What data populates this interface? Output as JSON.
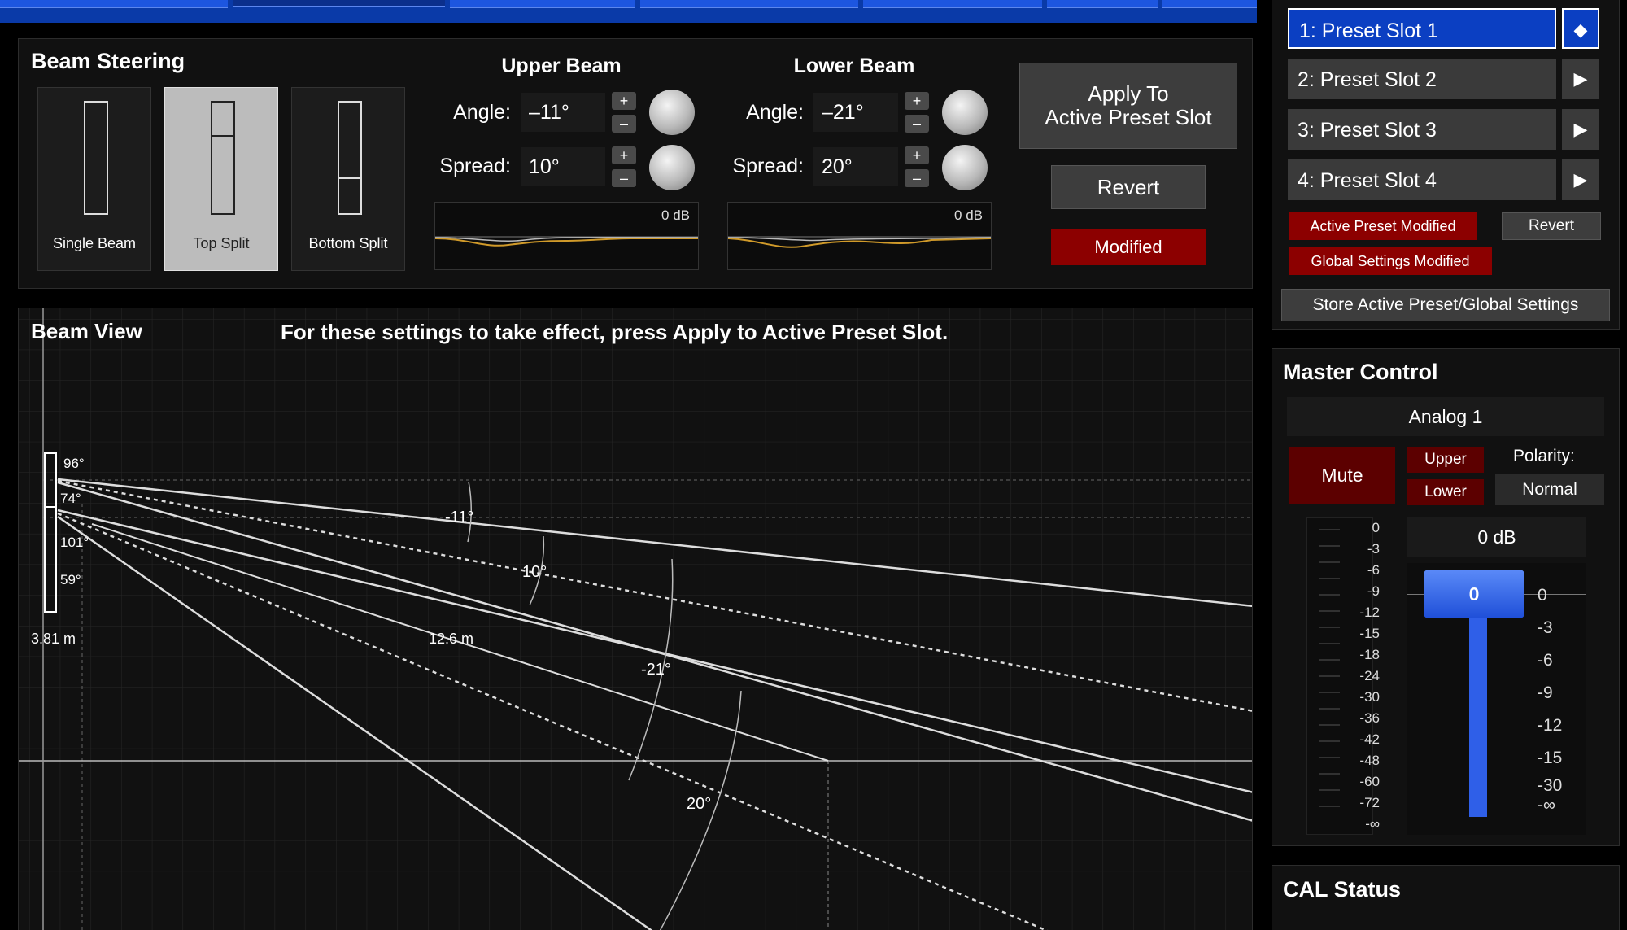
{
  "beam_steering": {
    "title": "Beam Steering",
    "modes": [
      "Single Beam",
      "Top Split",
      "Bottom Split"
    ],
    "upper": {
      "title": "Upper Beam",
      "angle": "–11°",
      "spread": "10°",
      "eq_db": "0 dB"
    },
    "lower": {
      "title": "Lower Beam",
      "angle": "–21°",
      "spread": "20°",
      "eq_db": "0 dB"
    },
    "angle_label": "Angle:",
    "spread_label": "Spread:",
    "plus": "+",
    "minus": "–",
    "apply_line1": "Apply To",
    "apply_line2": "Active Preset Slot",
    "revert": "Revert",
    "modified": "Modified"
  },
  "presets": {
    "slots": [
      "1: Preset Slot 1",
      "2: Preset Slot 2",
      "3: Preset Slot 3",
      "4: Preset Slot 4"
    ],
    "active_arrow": "◆",
    "arrow": "▶",
    "active_preset_modified": "Active Preset Modified",
    "revert": "Revert",
    "global_modified": "Global Settings Modified",
    "store": "Store Active Preset/Global Settings"
  },
  "beam_view": {
    "title": "Beam View",
    "notice": "For these settings to take effect, press Apply to Active Preset Slot.",
    "labels": {
      "a96": "96°",
      "a74": "74°",
      "a101": "101°",
      "a59": "59°",
      "height": "3.81 m",
      "distance": "12.6 m",
      "upper_angle": "-11°",
      "upper_spread": "10°",
      "lower_angle": "-21°",
      "lower_spread": "20°"
    }
  },
  "master": {
    "title": "Master Control",
    "input": "Analog 1",
    "mute": "Mute",
    "upper": "Upper",
    "lower": "Lower",
    "polarity_label": "Polarity:",
    "polarity": "Normal",
    "level": "0 dB",
    "fader_value": "0",
    "meter_scale": [
      "0",
      "-3",
      "-6",
      "-9",
      "-12",
      "-15",
      "-18",
      "-24",
      "-30",
      "-36",
      "-42",
      "-48",
      "-60",
      "-72",
      "-∞"
    ],
    "fader_scale": [
      "0",
      "-3",
      "-6",
      "-9",
      "-12",
      "-15",
      "-30",
      "-∞"
    ]
  },
  "cal": {
    "title": "CAL Status"
  }
}
